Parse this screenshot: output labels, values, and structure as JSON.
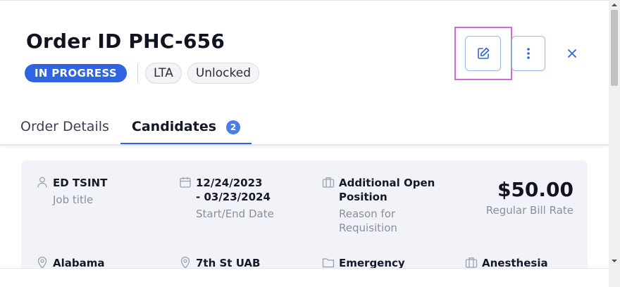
{
  "header": {
    "title": "Order ID PHC-656",
    "status": "IN PROGRESS",
    "chips": [
      "LTA",
      "Unlocked"
    ]
  },
  "actions": {
    "edit_icon": "edit-icon",
    "more_icon": "more-vertical-icon",
    "close_icon": "close-icon"
  },
  "tabs": [
    {
      "label": "Order Details",
      "active": false
    },
    {
      "label": "Candidates",
      "active": true,
      "count": "2"
    }
  ],
  "details": {
    "job_title": {
      "value": "ED TSINT",
      "label": "Job title",
      "icon": "person-icon"
    },
    "dates": {
      "value_line1": "12/24/2023",
      "value_line2": "- 03/23/2024",
      "label": "Start/End Date",
      "icon": "calendar-icon"
    },
    "reason": {
      "value_line1": "Additional Open",
      "value_line2": "Position",
      "label_line1": "Reason for",
      "label_line2": "Requisition",
      "icon": "briefcase-icon"
    },
    "rate": {
      "amount": "$50.00",
      "label": "Regular Bill Rate"
    },
    "row2": [
      {
        "value": "Alabama",
        "icon": "location-pin-icon"
      },
      {
        "value": "7th St UAB",
        "icon": "location-pin-icon"
      },
      {
        "value": "Emergency",
        "icon": "folder-icon"
      },
      {
        "value": "Anesthesia",
        "icon": "building-icon"
      }
    ]
  },
  "colors": {
    "accent": "#2f63e2",
    "focus_outline": "#d06ad6",
    "card_bg": "#f1f3f8",
    "muted_text": "#8a8f9e"
  }
}
